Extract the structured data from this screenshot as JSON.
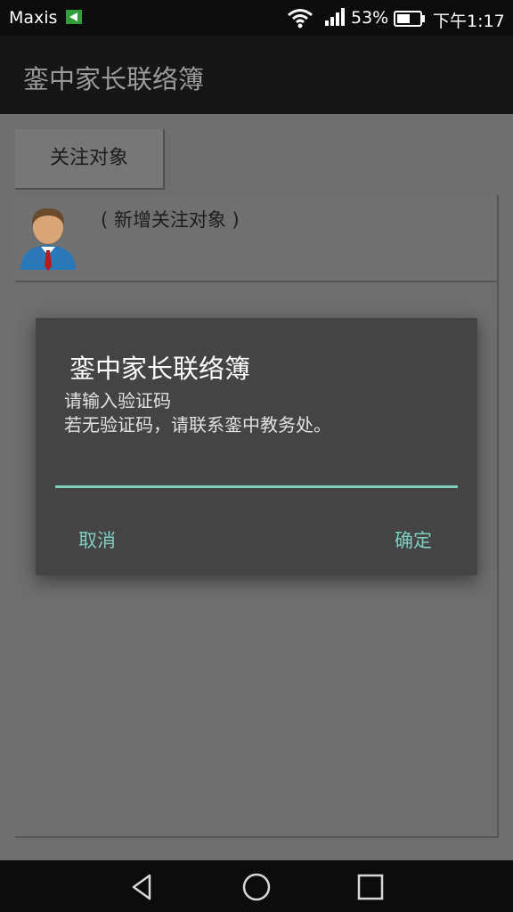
{
  "status_bar": {
    "carrier": "Maxis",
    "battery_percent": "53%",
    "time": "下午1:17",
    "icons": [
      "notification-flag-icon",
      "wifi-icon",
      "signal-icon",
      "battery-icon"
    ]
  },
  "app_bar": {
    "title": "銮中家长联络簿"
  },
  "tabs": [
    {
      "label": "关注对象"
    }
  ],
  "list": {
    "items": [
      {
        "label": "( 新增关注对象 )",
        "icon": "person-avatar-icon"
      }
    ]
  },
  "dialog": {
    "title": "銮中家长联络簿",
    "message_line1": "请输入验证码",
    "message_line2": "若无验证码，请联系銮中教务处。",
    "input_value": "",
    "cancel_label": "取消",
    "ok_label": "确定",
    "accent_color": "#7ecdc0"
  },
  "nav_bar": {
    "icons": [
      "back-icon",
      "home-icon",
      "recents-icon"
    ]
  }
}
